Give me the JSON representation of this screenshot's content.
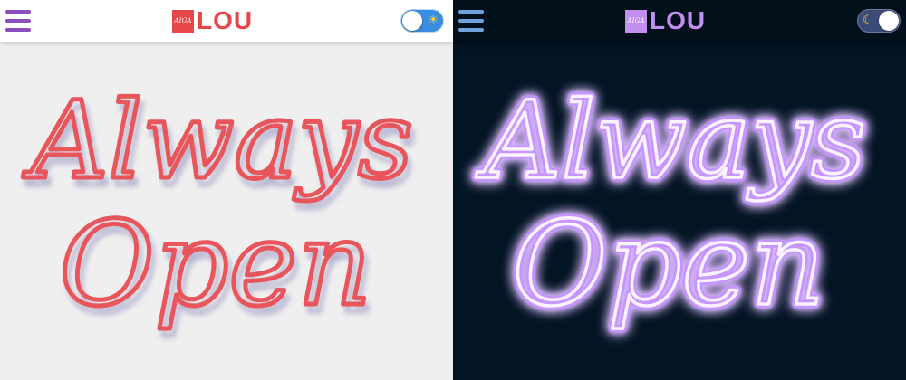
{
  "light": {
    "logo_box_text": "AIGA",
    "logo_word": "LOU",
    "toggle_icon": "sun-icon",
    "neon_line1": "Always",
    "neon_line2": "Open",
    "colors": {
      "background": "#efefef",
      "header": "#ffffff",
      "accent": "#8c4dbf",
      "logo": "#e8474a",
      "neon": "#e8555a",
      "toggle": "#3a8dde"
    }
  },
  "dark": {
    "logo_box_text": "AIGA",
    "logo_word": "LOU",
    "toggle_icon": "moon-icon",
    "neon_line1": "Always",
    "neon_line2": "Open",
    "colors": {
      "background": "#031523",
      "header": "#01101b",
      "accent": "#6fa2dd",
      "logo": "#c28ef0",
      "neon": "#f8eeff",
      "glow": "#b878ff",
      "toggle": "#3b4b78"
    }
  }
}
